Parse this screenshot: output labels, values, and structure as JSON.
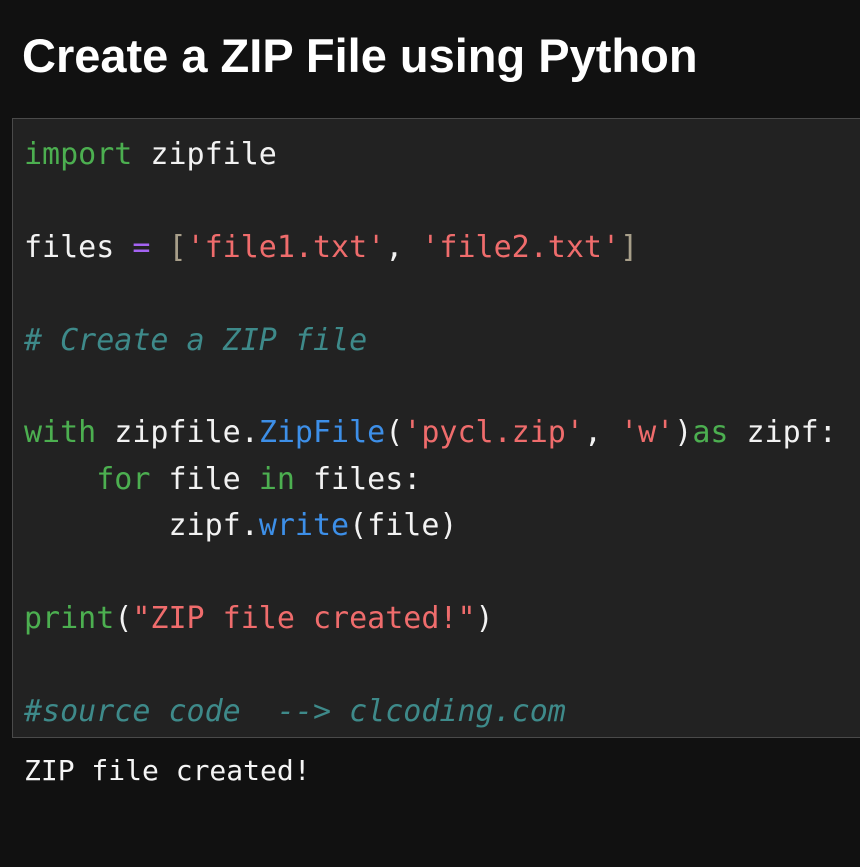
{
  "title": "Create a ZIP File using Python",
  "code": {
    "line1": {
      "kw": "import",
      "rest": " zipfile"
    },
    "line3": {
      "name": "files ",
      "op": "=",
      "sp": " ",
      "lbr": "[",
      "s1": "'file1.txt'",
      "comma": ", ",
      "s2": "'file2.txt'",
      "rbr": "]"
    },
    "line5": {
      "comment": "# Create a ZIP file"
    },
    "line7": {
      "kw_with": "with",
      "mod": " zipfile.",
      "cls": "ZipFile",
      "lp": "(",
      "s1": "'pycl.zip'",
      "comma": ", ",
      "s2": "'w'",
      "rp": ")",
      "kw_as": "as",
      "alias": " zipf:"
    },
    "line8": {
      "indent": "    ",
      "kw_for": "for",
      "var": " file ",
      "kw_in": "in",
      "iter": " files:"
    },
    "line9": {
      "indent": "        ",
      "obj": "zipf.",
      "method": "write",
      "args": "(file)"
    },
    "line11": {
      "fn": "print",
      "lp": "(",
      "s": "\"ZIP file created!\"",
      "rp": ")"
    },
    "line13": {
      "comment": "#source code  --> clcoding.com"
    }
  },
  "output": "ZIP file created!",
  "colors": {
    "background": "#111111",
    "cell_background": "#222222",
    "keyword": "#4caf50",
    "operator": "#a463f2",
    "string": "#ef6c6c",
    "function": "#3d8fe8",
    "comment": "#3e8a8a"
  }
}
